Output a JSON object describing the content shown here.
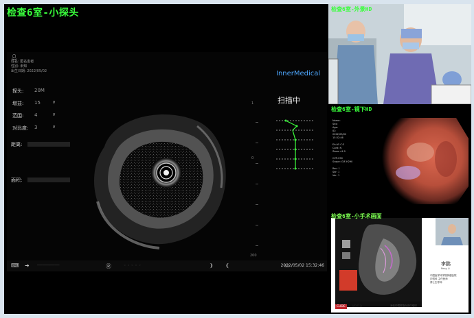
{
  "main": {
    "title": "检查6室-小探头",
    "info": {
      "person_icon": "person-icon",
      "name_line": "姓名: 匿名患者",
      "sex_line": "性别: 未知",
      "date_line": "出生日期: 2022/05/02"
    },
    "params": [
      {
        "label": "探头:",
        "value": "20M",
        "has_dropdown": false
      },
      {
        "label": "增益:",
        "value": "15",
        "has_dropdown": true
      },
      {
        "label": "范围:",
        "value": "4",
        "has_dropdown": true
      },
      {
        "label": "对比度:",
        "value": "3",
        "has_dropdown": true
      }
    ],
    "fields": [
      {
        "label": "距离:"
      },
      {
        "label": "面积:"
      }
    ],
    "brand": "InnerMedical",
    "scan_status": "扫描中",
    "scale_top": "1",
    "scale_mid": "0",
    "scale_bottom": "200",
    "datetime": "2022/05/02 15:32:46",
    "toolbar_icons": [
      "keyboard-icon",
      "arrow-right-icon",
      "reset-icon",
      "rotate-left-icon",
      "rotate-right-icon",
      "probe-icon"
    ]
  },
  "panels": [
    {
      "title": "检查6室-外景HD"
    },
    {
      "title": "检查6室-镜下HD",
      "osd": [
        "Name:",
        "Sex:",
        "Age:",
        "ID:",
        "2022/05/02",
        "15:32:46",
        "",
        "Eh:A5  C:3",
        "Cont: N",
        "Zoom x1.0",
        "",
        "CVP-290",
        "Scope: GIF-H290",
        "",
        "Rec: 1",
        "Ser: 1",
        "Ver: 1"
      ]
    },
    {
      "title": "检查6室-小手术画面",
      "presenter_name": "李鹏",
      "presenter_sub": "Peng Li",
      "presenter_detail": [
        "中国医学科学院肿瘤医院",
        "内镜科 主任医师",
        "博士生导师"
      ],
      "footer_logo": "CUDE",
      "footer_brand": "Voria",
      "footer_text": "消化内镜规范化诊疗培训"
    }
  ]
}
